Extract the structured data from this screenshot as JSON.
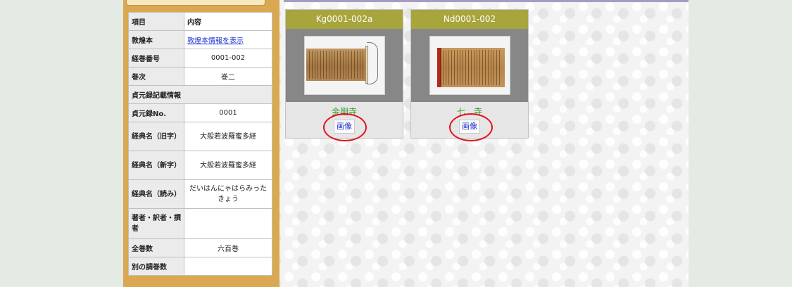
{
  "sidebar": {
    "rows": [
      {
        "key": "項目",
        "value": "内容"
      },
      {
        "key": "敦煌本",
        "value": "敦煌本情報を表示"
      },
      {
        "key": "経巻番号",
        "value": "0001-002"
      },
      {
        "key": "巻次",
        "value": "巻二"
      },
      {
        "header": "貞元録記載情報"
      },
      {
        "key": "貞元録No.",
        "value": "0001"
      },
      {
        "key": "経典名（旧字）",
        "value": "大般若波羅蜜多経"
      },
      {
        "key": "経典名（新字）",
        "value": "大般若波羅蜜多経"
      },
      {
        "key": "経典名（読み）",
        "value": "だいはんにゃはらみったきょう"
      },
      {
        "key": "著者・訳者・撰者",
        "value": ""
      },
      {
        "key": "全巻数",
        "value": "六百巻"
      },
      {
        "key": "別の調巻数",
        "value": ""
      }
    ]
  },
  "cards": [
    {
      "title": "Kg0001-002a",
      "caption": "金剛寺",
      "button": "画像"
    },
    {
      "title": "Nd0001-002",
      "caption": "七　寺",
      "button": "画像"
    }
  ],
  "colors": {
    "card_header": "#a7a53b",
    "caption": "#2e9a2e",
    "highlight_ring": "#e4101a",
    "sidebar_bg": "#d9a850"
  }
}
